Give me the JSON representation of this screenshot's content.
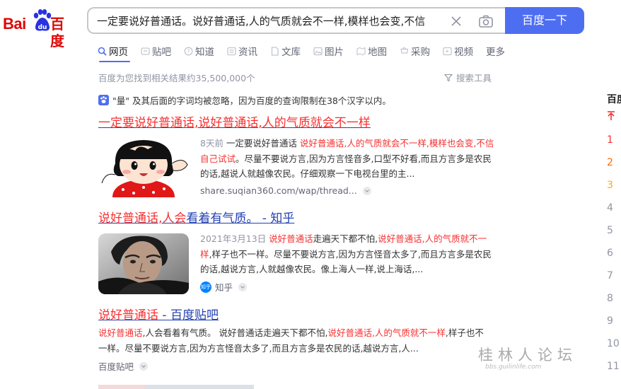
{
  "logo": {
    "latin": "Bai",
    "chinese": "百度"
  },
  "search": {
    "query": "一定要说好普通话。说好普通话,人的气质就会不一样,模样也会变,不信",
    "button_label": "百度一下"
  },
  "tabs": [
    {
      "label": "网页",
      "icon": "search-icon",
      "active": true
    },
    {
      "label": "贴吧",
      "icon": "tieba-icon"
    },
    {
      "label": "知道",
      "icon": "question-icon"
    },
    {
      "label": "资讯",
      "icon": "news-icon"
    },
    {
      "label": "文库",
      "icon": "document-icon"
    },
    {
      "label": "图片",
      "icon": "image-icon"
    },
    {
      "label": "地图",
      "icon": "map-icon"
    },
    {
      "label": "采购",
      "icon": "cart-icon"
    },
    {
      "label": "视频",
      "icon": "video-icon"
    },
    {
      "label": "更多"
    }
  ],
  "result_count": "百度为您找到相关结果约35,500,000个",
  "search_tools": "搜索工具",
  "notice": "\"量\" 及其后面的字词均被忽略，因为百度的查询限制在38个汉字以内。",
  "results": [
    {
      "title_parts": [
        {
          "text": "一定要说好普通话,说好普通话,人的气质就会不一样",
          "em": true
        }
      ],
      "date": "8天前",
      "snippet_parts": [
        {
          "text": " 一定要说好普通话 "
        },
        {
          "text": "说好普通话,人的气质就会不一样,模样也会变,不信自己试试",
          "em": true
        },
        {
          "text": "。尽量不要说方言,因为方言怪音多,口型不好看,而且方言多是农民的话,越说人就越像农民。仔细观察一下电视台里的主..."
        }
      ],
      "source": "share.suqian360.com/wap/thread..."
    },
    {
      "title_parts": [
        {
          "text": "说好普通话,人会",
          "em": true
        },
        {
          "text": "看着有气质。 - 知乎"
        }
      ],
      "date": "2021年3月13日",
      "snippet_parts": [
        {
          "text": " "
        },
        {
          "text": "说好普通话",
          "em": true
        },
        {
          "text": "走遍天下都不怕,"
        },
        {
          "text": "说好普通话,人的气质就不一样",
          "em": true
        },
        {
          "text": ",样子也不一样。尽量不要说方言,因为方言怪音太多了,而且方言多是农民的话,越说方言,人就越像农民。像上海人一样,说上海话,..."
        }
      ],
      "source": "知乎",
      "source_badge": "知乎"
    },
    {
      "title_parts": [
        {
          "text": "说好普通话",
          "em": true
        },
        {
          "text": " - 百度贴吧"
        }
      ],
      "snippet_parts": [
        {
          "text": "说好普通话",
          "em": true
        },
        {
          "text": ",人会看着有气质。 说好普通话走遍天下都不怕,"
        },
        {
          "text": "说好普通话,人的气质就不一样",
          "em": true
        },
        {
          "text": ",样子也不一样。尽量不要说方言,因为方言怪音太多了,而且方言多是农民的话,越说方言,人..."
        }
      ],
      "source": "百度贴吧"
    }
  ],
  "hot_list": {
    "title": "百度",
    "ranks": [
      "",
      "1",
      "2",
      "3",
      "4",
      "5",
      "6",
      "7",
      "8",
      "9",
      "10",
      "11"
    ]
  },
  "watermark": {
    "main": "桂林人论坛",
    "sub": "bbs.guilinlife.com"
  },
  "colors": {
    "brand_blue": "#4e6ef2",
    "highlight_red": "#f73131",
    "link_blue": "#2440b3",
    "logo_red": "#de0707"
  }
}
